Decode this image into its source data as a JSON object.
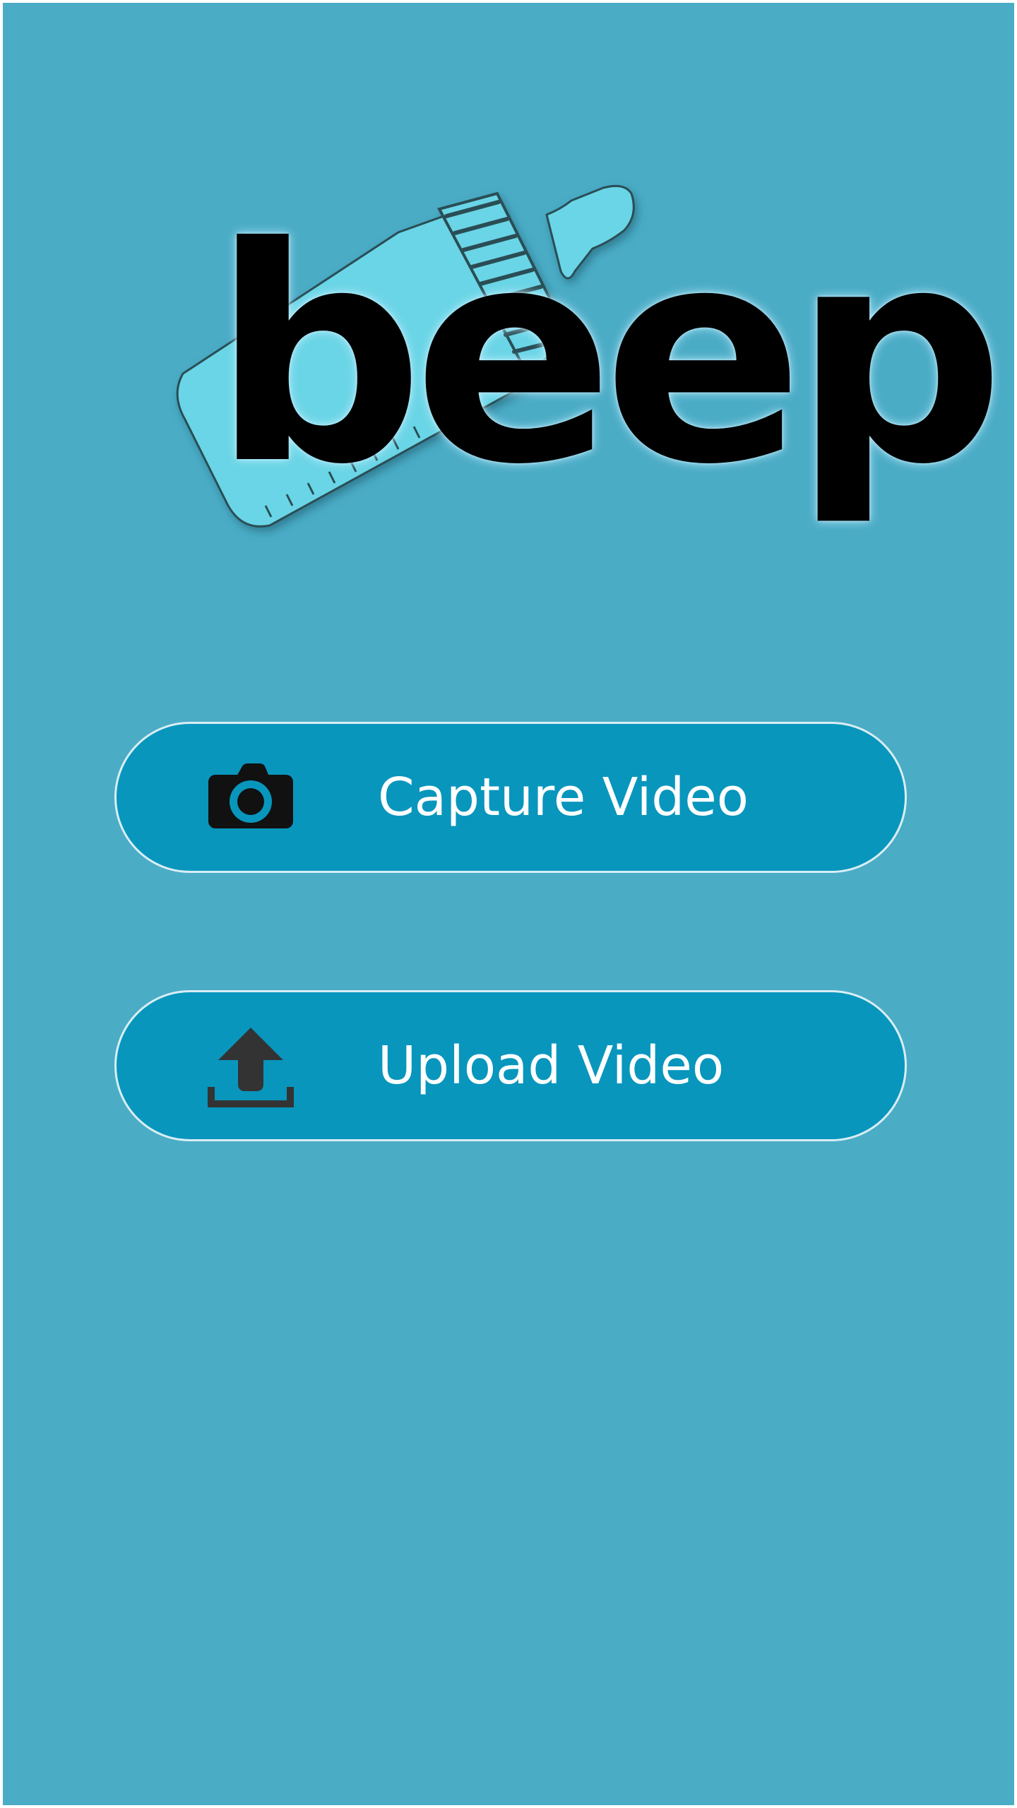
{
  "app": {
    "logo_text": "beep.",
    "logo_icon": "baby-bottle-icon",
    "colors": {
      "background": "#4bacc6",
      "button_fill": "#0896bd",
      "button_border": "#d9eef4",
      "bottle_fill": "#6bd5e6",
      "bottle_outline": "#2a4e55"
    }
  },
  "actions": {
    "capture": {
      "label": "Capture Video",
      "icon": "camera-icon"
    },
    "upload": {
      "label": "Upload Video",
      "icon": "upload-icon"
    }
  }
}
